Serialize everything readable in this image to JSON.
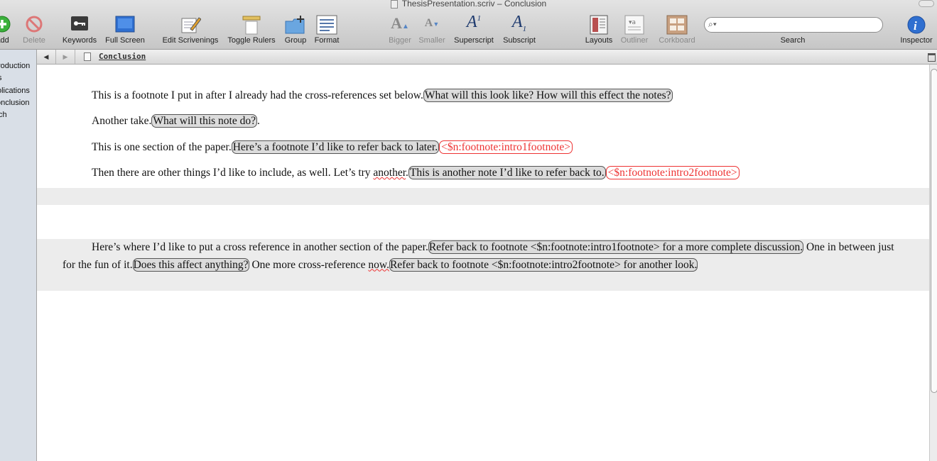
{
  "window": {
    "title": "ThesisPresentation.scriv – Conclusion"
  },
  "toolbar": {
    "add": "Add",
    "delete": "Delete",
    "keywords": "Keywords",
    "fullscreen": "Full Screen",
    "edit_scrivenings": "Edit Scrivenings",
    "toggle_rulers": "Toggle Rulers",
    "group": "Group",
    "format": "Format",
    "bigger": "Bigger",
    "smaller": "Smaller",
    "superscript": "Superscript",
    "subscript": "Subscript",
    "layouts": "Layouts",
    "outliner": "Outliner",
    "corkboard": "Corkboard",
    "search_label": "Search",
    "search_value": "",
    "inspector": "Inspector"
  },
  "binder": {
    "items": [
      "roduction",
      "s",
      "olications",
      "onclusion",
      "ch"
    ]
  },
  "header": {
    "back": "◀",
    "forward": "▶",
    "title": "Conclusion"
  },
  "body": {
    "p1": {
      "text": "This is a footnote I put in after I already had the cross-references set below.",
      "note": "What will this look like? How will this effect the notes?"
    },
    "p2": {
      "text": "Another take.",
      "note": "What will this note do?",
      "after": "."
    },
    "p3": {
      "text": "This is one section of the paper.",
      "note": "Here’s a footnote I’d like to refer back to later.",
      "ref": "<$n:footnote:intro1footnote>"
    },
    "p4": {
      "text_a": "Then there are other things I’d like to include, as well. Let’s try ",
      "text_b": "another",
      "text_c": ".",
      "note": "This is another note I’d like to refer back to.",
      "ref": "<$n:footnote:intro2footnote>"
    },
    "conclusion": {
      "text1": "Here’s where I’d like to put a cross reference in another section of the paper.",
      "note1": "Refer back to footnote <$n:footnote:intro1footnote> for a more complete discussion.",
      "text2": " One in between just for the fun of it.",
      "note2": "Does this affect anything?",
      "text3a": " One more cross-reference ",
      "text3b": "now.",
      "note3": "Refer back to footnote <$n:footnote:intro2footnote> for another look."
    }
  }
}
